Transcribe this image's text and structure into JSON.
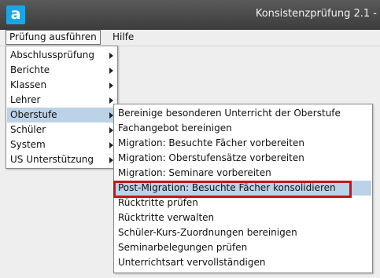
{
  "window": {
    "title": "Konsistenzprüfung 2.1 -",
    "logo_letter": "a"
  },
  "menubar": {
    "items": [
      "Prüfung ausführen",
      "Hilfe"
    ]
  },
  "main_menu": {
    "items": [
      {
        "label": "Abschlussprüfung",
        "submenu": true
      },
      {
        "label": "Berichte",
        "submenu": true
      },
      {
        "label": "Klassen",
        "submenu": true
      },
      {
        "label": "Lehrer",
        "submenu": true
      },
      {
        "label": "Oberstufe",
        "submenu": true,
        "selected": true
      },
      {
        "label": "Schüler",
        "submenu": true
      },
      {
        "label": "System",
        "submenu": true
      },
      {
        "label": "US Unterstützung",
        "submenu": true
      }
    ]
  },
  "oberstufe_menu": {
    "items": [
      {
        "label": "Bereinige besonderen Unterricht der Oberstufe"
      },
      {
        "label": "Fachangebot bereinigen"
      },
      {
        "label": "Migration: Besuchte Fächer vorbereiten"
      },
      {
        "label": "Migration: Oberstufensätze vorbereiten"
      },
      {
        "label": "Migration: Seminare vorbereiten"
      },
      {
        "label": "Post-Migration: Besuchte Fächer konsolidieren",
        "selected": true,
        "highlighted": true
      },
      {
        "label": "Rücktritte prüfen"
      },
      {
        "label": "Rücktritte verwalten"
      },
      {
        "label": "Schüler-Kurs-Zuordnungen bereinigen"
      },
      {
        "label": "Seminarbelegungen prüfen"
      },
      {
        "label": "Unterrichtsart vervollständigen"
      }
    ]
  },
  "colors": {
    "selection": "#bcd2e6",
    "highlight_border": "#c0161c",
    "titlebar": "#4a4a4a",
    "logo": "#1aa6e6"
  }
}
